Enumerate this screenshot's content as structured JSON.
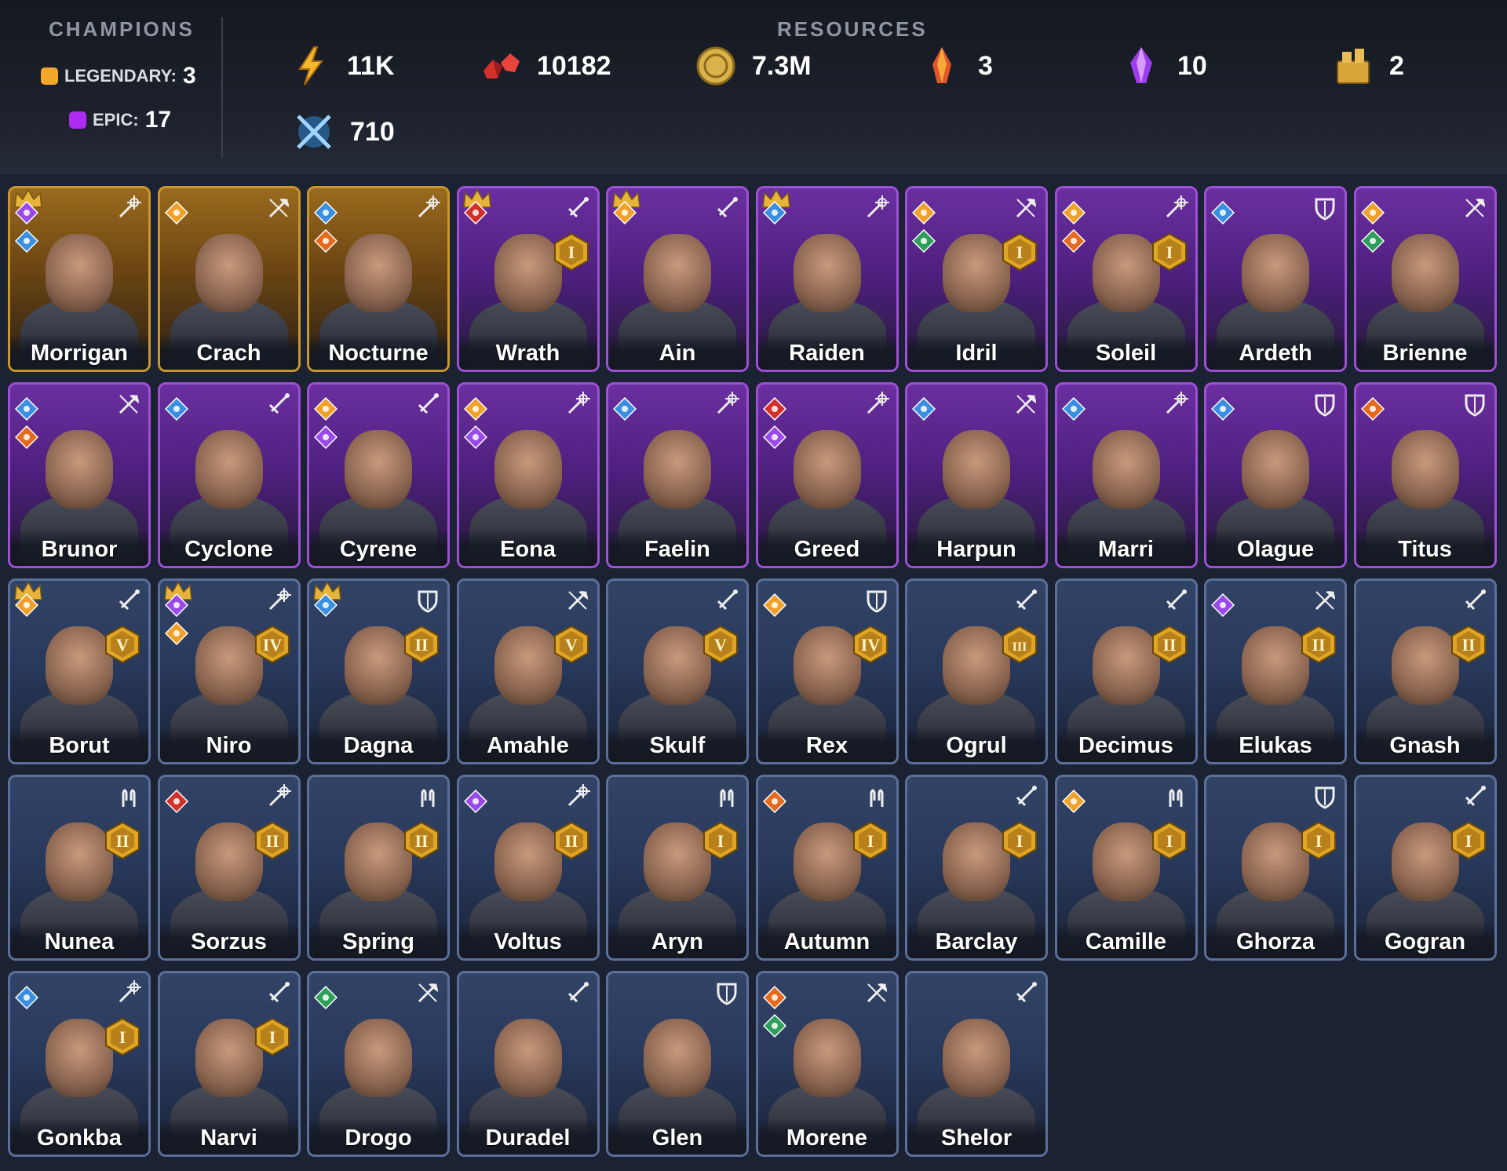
{
  "champions": {
    "title": "CHAMPIONS",
    "legendary_label": "LEGENDARY:",
    "legendary_count": "3",
    "epic_label": "EPIC:",
    "epic_count": "17"
  },
  "resources": {
    "title": "RESOURCES",
    "items": [
      {
        "icon": "energy-bolt-icon",
        "value": "11K"
      },
      {
        "icon": "ruby-gems-icon",
        "value": "10182"
      },
      {
        "icon": "gold-coin-icon",
        "value": "7.3M"
      },
      {
        "icon": "fire-crystal-icon",
        "value": "3"
      },
      {
        "icon": "purple-crystal-icon",
        "value": "10"
      },
      {
        "icon": "gold-chest-icon",
        "value": "2"
      },
      {
        "icon": "crossed-swords-icon",
        "value": "710"
      }
    ]
  },
  "colors": {
    "legendary": "#f2a72a",
    "epic": "#b02bf2",
    "rare": "#4b5b80"
  },
  "cards": [
    {
      "name": "Morrigan",
      "rarity": "legendary",
      "cls": "wand",
      "crown": true,
      "aff": [
        "void",
        "magic"
      ],
      "rank": ""
    },
    {
      "name": "Crach",
      "rarity": "legendary",
      "cls": "axe",
      "crown": false,
      "aff": [
        "force"
      ],
      "rank": ""
    },
    {
      "name": "Nocturne",
      "rarity": "legendary",
      "cls": "wand",
      "crown": false,
      "aff": [
        "magic",
        "fire"
      ],
      "rank": ""
    },
    {
      "name": "Wrath",
      "rarity": "epic",
      "cls": "sword",
      "crown": true,
      "aff": [
        "chaos"
      ],
      "rank": "I"
    },
    {
      "name": "Ain",
      "rarity": "epic",
      "cls": "sword",
      "crown": true,
      "aff": [
        "force"
      ],
      "rank": ""
    },
    {
      "name": "Raiden",
      "rarity": "epic",
      "cls": "wand",
      "crown": true,
      "aff": [
        "magic"
      ],
      "rank": ""
    },
    {
      "name": "Idril",
      "rarity": "epic",
      "cls": "axe",
      "crown": false,
      "aff": [
        "force",
        "nature"
      ],
      "rank": "I"
    },
    {
      "name": "Soleil",
      "rarity": "epic",
      "cls": "wand",
      "crown": false,
      "aff": [
        "force",
        "fire"
      ],
      "rank": "I"
    },
    {
      "name": "Ardeth",
      "rarity": "epic",
      "cls": "shield",
      "crown": false,
      "aff": [
        "magic"
      ],
      "rank": ""
    },
    {
      "name": "Brienne",
      "rarity": "epic",
      "cls": "axe",
      "crown": false,
      "aff": [
        "force",
        "nature"
      ],
      "rank": ""
    },
    {
      "name": "Brunor",
      "rarity": "epic",
      "cls": "axe",
      "crown": false,
      "aff": [
        "magic",
        "fire"
      ],
      "rank": ""
    },
    {
      "name": "Cyclone",
      "rarity": "epic",
      "cls": "sword",
      "crown": false,
      "aff": [
        "magic"
      ],
      "rank": ""
    },
    {
      "name": "Cyrene",
      "rarity": "epic",
      "cls": "sword",
      "crown": false,
      "aff": [
        "force",
        "void"
      ],
      "rank": ""
    },
    {
      "name": "Eona",
      "rarity": "epic",
      "cls": "wand",
      "crown": false,
      "aff": [
        "force",
        "void"
      ],
      "rank": ""
    },
    {
      "name": "Faelin",
      "rarity": "epic",
      "cls": "wand",
      "crown": false,
      "aff": [
        "magic"
      ],
      "rank": ""
    },
    {
      "name": "Greed",
      "rarity": "epic",
      "cls": "wand",
      "crown": false,
      "aff": [
        "chaos",
        "void"
      ],
      "rank": ""
    },
    {
      "name": "Harpun",
      "rarity": "epic",
      "cls": "axe",
      "crown": false,
      "aff": [
        "magic"
      ],
      "rank": ""
    },
    {
      "name": "Marri",
      "rarity": "epic",
      "cls": "wand",
      "crown": false,
      "aff": [
        "magic"
      ],
      "rank": ""
    },
    {
      "name": "Olague",
      "rarity": "epic",
      "cls": "shield",
      "crown": false,
      "aff": [
        "magic"
      ],
      "rank": ""
    },
    {
      "name": "Titus",
      "rarity": "epic",
      "cls": "shield",
      "crown": false,
      "aff": [
        "fire"
      ],
      "rank": ""
    },
    {
      "name": "Borut",
      "rarity": "rare",
      "cls": "sword",
      "crown": true,
      "aff": [
        "force"
      ],
      "rank": "V"
    },
    {
      "name": "Niro",
      "rarity": "rare",
      "cls": "wand",
      "crown": true,
      "aff": [
        "void",
        "force"
      ],
      "rank": "IV"
    },
    {
      "name": "Dagna",
      "rarity": "rare",
      "cls": "shield",
      "crown": true,
      "aff": [
        "magic"
      ],
      "rank": "II"
    },
    {
      "name": "Amahle",
      "rarity": "rare",
      "cls": "axe",
      "crown": false,
      "aff": [],
      "rank": "V"
    },
    {
      "name": "Skulf",
      "rarity": "rare",
      "cls": "sword",
      "crown": false,
      "aff": [],
      "rank": "V"
    },
    {
      "name": "Rex",
      "rarity": "rare",
      "cls": "shield",
      "crown": false,
      "aff": [
        "force"
      ],
      "rank": "IV"
    },
    {
      "name": "Ogrul",
      "rarity": "rare",
      "cls": "sword",
      "crown": false,
      "aff": [],
      "rank": "III"
    },
    {
      "name": "Decimus",
      "rarity": "rare",
      "cls": "sword",
      "crown": false,
      "aff": [],
      "rank": "II"
    },
    {
      "name": "Elukas",
      "rarity": "rare",
      "cls": "axe",
      "crown": false,
      "aff": [
        "void"
      ],
      "rank": "II"
    },
    {
      "name": "Gnash",
      "rarity": "rare",
      "cls": "sword",
      "crown": false,
      "aff": [],
      "rank": "II"
    },
    {
      "name": "Nunea",
      "rarity": "rare",
      "cls": "hands",
      "crown": false,
      "aff": [],
      "rank": "II"
    },
    {
      "name": "Sorzus",
      "rarity": "rare",
      "cls": "wand",
      "crown": false,
      "aff": [
        "chaos"
      ],
      "rank": "II"
    },
    {
      "name": "Spring",
      "rarity": "rare",
      "cls": "hands",
      "crown": false,
      "aff": [],
      "rank": "II"
    },
    {
      "name": "Voltus",
      "rarity": "rare",
      "cls": "wand",
      "crown": false,
      "aff": [
        "void"
      ],
      "rank": "II"
    },
    {
      "name": "Aryn",
      "rarity": "rare",
      "cls": "hands",
      "crown": false,
      "aff": [],
      "rank": "I"
    },
    {
      "name": "Autumn",
      "rarity": "rare",
      "cls": "hands",
      "crown": false,
      "aff": [
        "fire"
      ],
      "rank": "I"
    },
    {
      "name": "Barclay",
      "rarity": "rare",
      "cls": "sword",
      "crown": false,
      "aff": [],
      "rank": "I"
    },
    {
      "name": "Camille",
      "rarity": "rare",
      "cls": "hands",
      "crown": false,
      "aff": [
        "force"
      ],
      "rank": "I"
    },
    {
      "name": "Ghorza",
      "rarity": "rare",
      "cls": "shield",
      "crown": false,
      "aff": [],
      "rank": "I"
    },
    {
      "name": "Gogran",
      "rarity": "rare",
      "cls": "sword",
      "crown": false,
      "aff": [],
      "rank": "I"
    },
    {
      "name": "Gonkba",
      "rarity": "rare",
      "cls": "wand",
      "crown": false,
      "aff": [
        "magic"
      ],
      "rank": "I"
    },
    {
      "name": "Narvi",
      "rarity": "rare",
      "cls": "sword",
      "crown": false,
      "aff": [],
      "rank": "I"
    },
    {
      "name": "Drogo",
      "rarity": "rare",
      "cls": "axe",
      "crown": false,
      "aff": [
        "nature"
      ],
      "rank": ""
    },
    {
      "name": "Duradel",
      "rarity": "rare",
      "cls": "sword",
      "crown": false,
      "aff": [],
      "rank": ""
    },
    {
      "name": "Glen",
      "rarity": "rare",
      "cls": "shield",
      "crown": false,
      "aff": [],
      "rank": ""
    },
    {
      "name": "Morene",
      "rarity": "rare",
      "cls": "axe",
      "crown": false,
      "aff": [
        "fire",
        "nature"
      ],
      "rank": ""
    },
    {
      "name": "Shelor",
      "rarity": "rare",
      "cls": "sword",
      "crown": false,
      "aff": [],
      "rank": ""
    }
  ]
}
